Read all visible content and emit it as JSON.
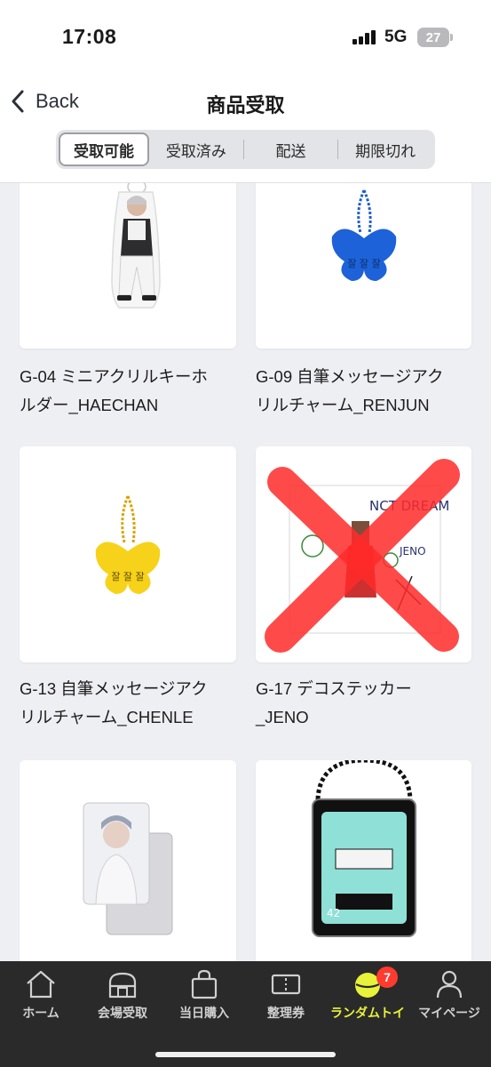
{
  "status_bar": {
    "time": "17:08",
    "network": "5G",
    "battery": "27"
  },
  "nav": {
    "back_label": "Back",
    "title": "商品受取"
  },
  "segments": [
    {
      "label": "受取可能",
      "active": true
    },
    {
      "label": "受取済み",
      "active": false
    },
    {
      "label": "配送",
      "active": false
    },
    {
      "label": "期限切れ",
      "active": false
    }
  ],
  "items": [
    {
      "title_line1": "G-04 ミニアクリルキーホ",
      "title_line2": "ルダー_HAECHAN"
    },
    {
      "title_line1": "G-09 自筆メッセージアク",
      "title_line2": "リルチャーム_RENJUN"
    },
    {
      "title_line1": "G-13 自筆メッセージアク",
      "title_line2": "リルチャーム_CHENLE"
    },
    {
      "title_line1": "G-17 デコステッカー",
      "title_line2": "_JENO"
    }
  ],
  "product_art": {
    "sticker_top": "NCT DREAM",
    "sticker_name": "JENO",
    "keyring_number": "42"
  },
  "tabbar": {
    "items": [
      {
        "label": "ホーム",
        "icon": "home-icon"
      },
      {
        "label": "会場受取",
        "icon": "store-icon"
      },
      {
        "label": "当日購入",
        "icon": "shopping-bag-icon"
      },
      {
        "label": "整理券",
        "icon": "ticket-icon"
      },
      {
        "label": "ランダムトイ",
        "icon": "random-toy-icon",
        "active": true,
        "badge": "7"
      },
      {
        "label": "マイページ",
        "icon": "person-icon"
      }
    ]
  },
  "colors": {
    "accent": "#e9f23a",
    "badge": "#ff3b30",
    "tabbar_bg": "#2a2a2a",
    "page_bg": "#eeeff3"
  }
}
